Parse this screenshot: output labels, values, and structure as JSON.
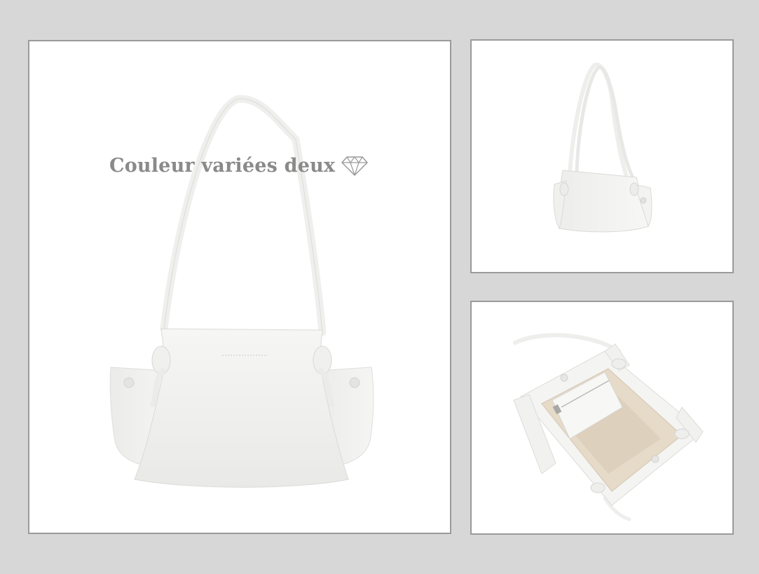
{
  "main_panel": {
    "caption": "Couleur variées deux",
    "caption_icon": "diamond-icon",
    "product": "white-leather-shoulder-bag-front"
  },
  "top_right_panel": {
    "product": "white-leather-shoulder-bag-angled"
  },
  "bottom_right_panel": {
    "product": "white-leather-shoulder-bag-interior-open"
  },
  "colors": {
    "page_background": "#d7d7d7",
    "panel_background": "#ffffff",
    "panel_border": "#9a9a9a",
    "caption_text": "#8a8a8a",
    "bag_leather": "#f2f2f0",
    "bag_lining": "#e5d8c6"
  }
}
